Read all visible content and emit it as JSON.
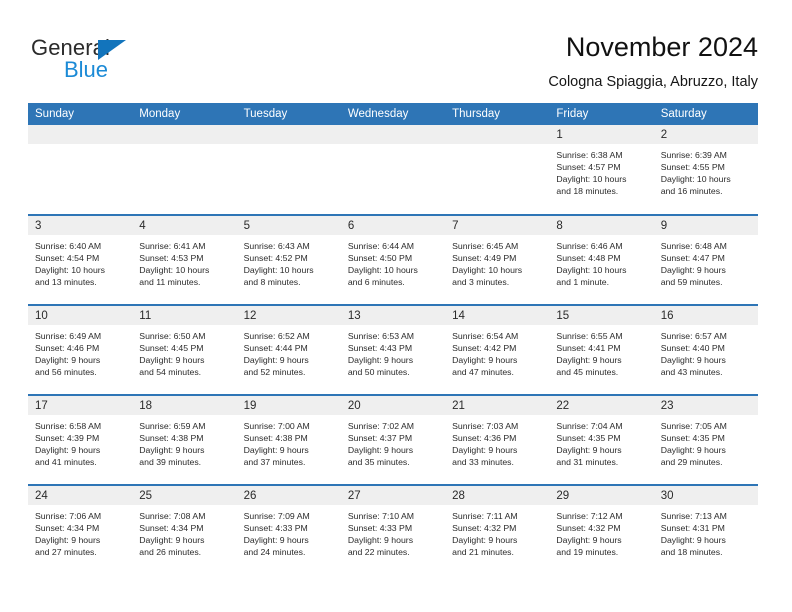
{
  "brand": {
    "name_part1": "General",
    "name_part2": "Blue",
    "triangle_color": "#1274bc",
    "blue_text_color": "#1b8ad6"
  },
  "header": {
    "title": "November 2024",
    "subtitle": "Cologna Spiaggia, Abruzzo, Italy"
  },
  "theme": {
    "header_blue": "#2E75B6",
    "daynum_band": "#efefef",
    "cell_background": "#ffffff",
    "text_color": "#2b2b2b"
  },
  "weekday_headers": [
    "Sunday",
    "Monday",
    "Tuesday",
    "Wednesday",
    "Thursday",
    "Friday",
    "Saturday"
  ],
  "weeks": [
    [
      {
        "day": "",
        "lines": []
      },
      {
        "day": "",
        "lines": []
      },
      {
        "day": "",
        "lines": []
      },
      {
        "day": "",
        "lines": []
      },
      {
        "day": "",
        "lines": []
      },
      {
        "day": "1",
        "lines": [
          "Sunrise: 6:38 AM",
          "Sunset: 4:57 PM",
          "Daylight: 10 hours",
          "and 18 minutes."
        ]
      },
      {
        "day": "2",
        "lines": [
          "Sunrise: 6:39 AM",
          "Sunset: 4:55 PM",
          "Daylight: 10 hours",
          "and 16 minutes."
        ]
      }
    ],
    [
      {
        "day": "3",
        "lines": [
          "Sunrise: 6:40 AM",
          "Sunset: 4:54 PM",
          "Daylight: 10 hours",
          "and 13 minutes."
        ]
      },
      {
        "day": "4",
        "lines": [
          "Sunrise: 6:41 AM",
          "Sunset: 4:53 PM",
          "Daylight: 10 hours",
          "and 11 minutes."
        ]
      },
      {
        "day": "5",
        "lines": [
          "Sunrise: 6:43 AM",
          "Sunset: 4:52 PM",
          "Daylight: 10 hours",
          "and 8 minutes."
        ]
      },
      {
        "day": "6",
        "lines": [
          "Sunrise: 6:44 AM",
          "Sunset: 4:50 PM",
          "Daylight: 10 hours",
          "and 6 minutes."
        ]
      },
      {
        "day": "7",
        "lines": [
          "Sunrise: 6:45 AM",
          "Sunset: 4:49 PM",
          "Daylight: 10 hours",
          "and 3 minutes."
        ]
      },
      {
        "day": "8",
        "lines": [
          "Sunrise: 6:46 AM",
          "Sunset: 4:48 PM",
          "Daylight: 10 hours",
          "and 1 minute."
        ]
      },
      {
        "day": "9",
        "lines": [
          "Sunrise: 6:48 AM",
          "Sunset: 4:47 PM",
          "Daylight: 9 hours",
          "and 59 minutes."
        ]
      }
    ],
    [
      {
        "day": "10",
        "lines": [
          "Sunrise: 6:49 AM",
          "Sunset: 4:46 PM",
          "Daylight: 9 hours",
          "and 56 minutes."
        ]
      },
      {
        "day": "11",
        "lines": [
          "Sunrise: 6:50 AM",
          "Sunset: 4:45 PM",
          "Daylight: 9 hours",
          "and 54 minutes."
        ]
      },
      {
        "day": "12",
        "lines": [
          "Sunrise: 6:52 AM",
          "Sunset: 4:44 PM",
          "Daylight: 9 hours",
          "and 52 minutes."
        ]
      },
      {
        "day": "13",
        "lines": [
          "Sunrise: 6:53 AM",
          "Sunset: 4:43 PM",
          "Daylight: 9 hours",
          "and 50 minutes."
        ]
      },
      {
        "day": "14",
        "lines": [
          "Sunrise: 6:54 AM",
          "Sunset: 4:42 PM",
          "Daylight: 9 hours",
          "and 47 minutes."
        ]
      },
      {
        "day": "15",
        "lines": [
          "Sunrise: 6:55 AM",
          "Sunset: 4:41 PM",
          "Daylight: 9 hours",
          "and 45 minutes."
        ]
      },
      {
        "day": "16",
        "lines": [
          "Sunrise: 6:57 AM",
          "Sunset: 4:40 PM",
          "Daylight: 9 hours",
          "and 43 minutes."
        ]
      }
    ],
    [
      {
        "day": "17",
        "lines": [
          "Sunrise: 6:58 AM",
          "Sunset: 4:39 PM",
          "Daylight: 9 hours",
          "and 41 minutes."
        ]
      },
      {
        "day": "18",
        "lines": [
          "Sunrise: 6:59 AM",
          "Sunset: 4:38 PM",
          "Daylight: 9 hours",
          "and 39 minutes."
        ]
      },
      {
        "day": "19",
        "lines": [
          "Sunrise: 7:00 AM",
          "Sunset: 4:38 PM",
          "Daylight: 9 hours",
          "and 37 minutes."
        ]
      },
      {
        "day": "20",
        "lines": [
          "Sunrise: 7:02 AM",
          "Sunset: 4:37 PM",
          "Daylight: 9 hours",
          "and 35 minutes."
        ]
      },
      {
        "day": "21",
        "lines": [
          "Sunrise: 7:03 AM",
          "Sunset: 4:36 PM",
          "Daylight: 9 hours",
          "and 33 minutes."
        ]
      },
      {
        "day": "22",
        "lines": [
          "Sunrise: 7:04 AM",
          "Sunset: 4:35 PM",
          "Daylight: 9 hours",
          "and 31 minutes."
        ]
      },
      {
        "day": "23",
        "lines": [
          "Sunrise: 7:05 AM",
          "Sunset: 4:35 PM",
          "Daylight: 9 hours",
          "and 29 minutes."
        ]
      }
    ],
    [
      {
        "day": "24",
        "lines": [
          "Sunrise: 7:06 AM",
          "Sunset: 4:34 PM",
          "Daylight: 9 hours",
          "and 27 minutes."
        ]
      },
      {
        "day": "25",
        "lines": [
          "Sunrise: 7:08 AM",
          "Sunset: 4:34 PM",
          "Daylight: 9 hours",
          "and 26 minutes."
        ]
      },
      {
        "day": "26",
        "lines": [
          "Sunrise: 7:09 AM",
          "Sunset: 4:33 PM",
          "Daylight: 9 hours",
          "and 24 minutes."
        ]
      },
      {
        "day": "27",
        "lines": [
          "Sunrise: 7:10 AM",
          "Sunset: 4:33 PM",
          "Daylight: 9 hours",
          "and 22 minutes."
        ]
      },
      {
        "day": "28",
        "lines": [
          "Sunrise: 7:11 AM",
          "Sunset: 4:32 PM",
          "Daylight: 9 hours",
          "and 21 minutes."
        ]
      },
      {
        "day": "29",
        "lines": [
          "Sunrise: 7:12 AM",
          "Sunset: 4:32 PM",
          "Daylight: 9 hours",
          "and 19 minutes."
        ]
      },
      {
        "day": "30",
        "lines": [
          "Sunrise: 7:13 AM",
          "Sunset: 4:31 PM",
          "Daylight: 9 hours",
          "and 18 minutes."
        ]
      }
    ]
  ]
}
